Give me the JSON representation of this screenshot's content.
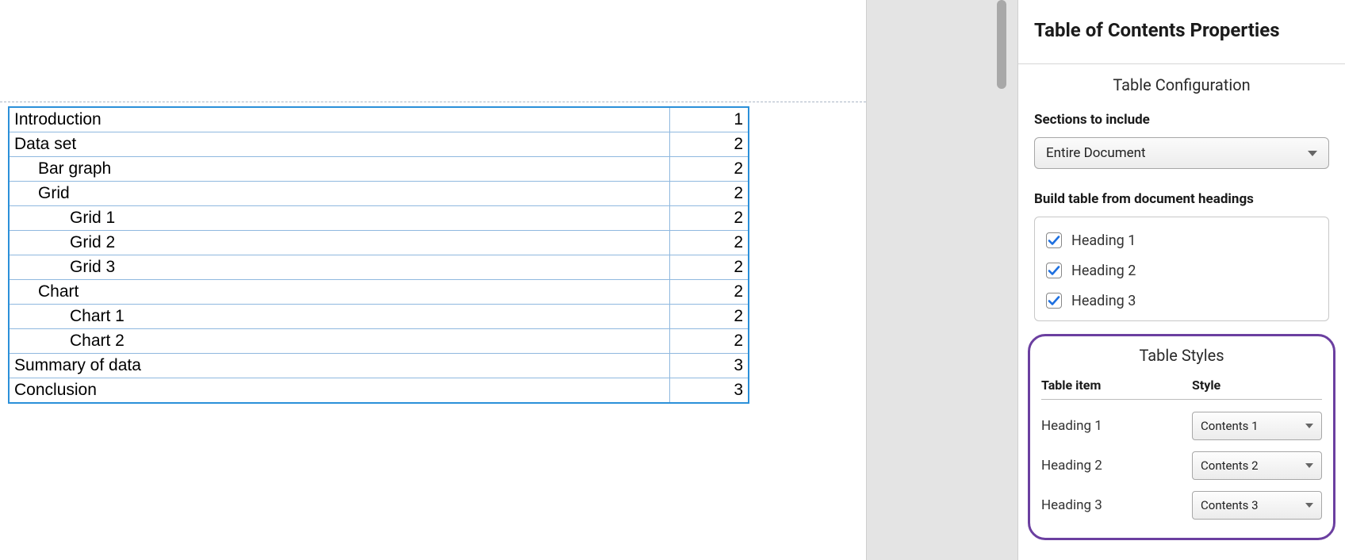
{
  "toc": {
    "rows": [
      {
        "label": "Introduction",
        "page": "1",
        "indent": 0
      },
      {
        "label": "Data set",
        "page": "2",
        "indent": 0
      },
      {
        "label": "Bar graph",
        "page": "2",
        "indent": 1
      },
      {
        "label": "Grid",
        "page": "2",
        "indent": 1
      },
      {
        "label": "Grid 1",
        "page": "2",
        "indent": 2
      },
      {
        "label": "Grid 2",
        "page": "2",
        "indent": 2
      },
      {
        "label": "Grid 3",
        "page": "2",
        "indent": 2
      },
      {
        "label": "Chart",
        "page": "2",
        "indent": 1
      },
      {
        "label": "Chart 1",
        "page": "2",
        "indent": 2
      },
      {
        "label": "Chart 2",
        "page": "2",
        "indent": 2
      },
      {
        "label": "Summary of data",
        "page": "3",
        "indent": 0
      },
      {
        "label": "Conclusion",
        "page": "3",
        "indent": 0
      }
    ]
  },
  "panel": {
    "title": "Table of Contents Properties",
    "config_heading": "Table Configuration",
    "sections_label": "Sections to include",
    "sections_value": "Entire Document",
    "build_label": "Build table from document headings",
    "headings": [
      {
        "label": "Heading 1",
        "checked": true
      },
      {
        "label": "Heading 2",
        "checked": true
      },
      {
        "label": "Heading 3",
        "checked": true
      }
    ],
    "styles_heading": "Table Styles",
    "styles_col1": "Table item",
    "styles_col2": "Style",
    "styles_rows": [
      {
        "item": "Heading 1",
        "style": "Contents 1"
      },
      {
        "item": "Heading 2",
        "style": "Contents 2"
      },
      {
        "item": "Heading 3",
        "style": "Contents 3"
      }
    ]
  }
}
